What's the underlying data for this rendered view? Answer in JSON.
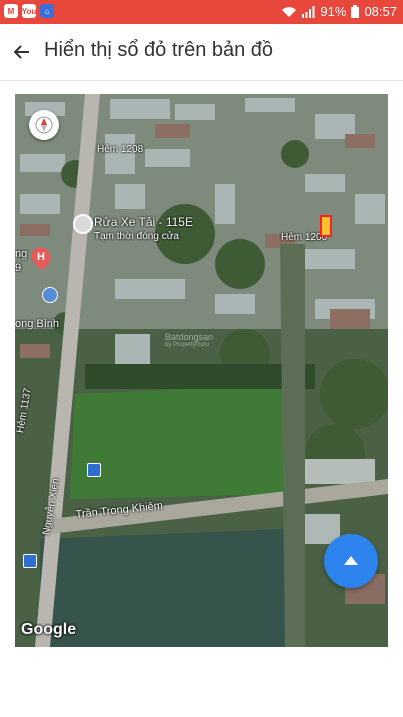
{
  "status_bar": {
    "app_icons": [
      "M",
      "You",
      "home"
    ],
    "battery": "91%",
    "time": "08:57",
    "color": "#e8473c"
  },
  "header": {
    "title": "Hiển thị sổ đỏ trên bản đồ",
    "back_icon": "arrow-left-icon"
  },
  "map": {
    "poi": {
      "name": "Rửa Xe Tải - 115E",
      "status": "Tạm thời đóng cửa"
    },
    "hospital_marker": "H",
    "street_labels": {
      "hem_1208": "Hẻm 1208",
      "hem_1200": "Hẻm 1200",
      "hem_1137": "Hẻm 1137",
      "nguyen_xien": "Nguyễn Xiển",
      "tran_trong_khiem": "Trần Trọng Khiêm",
      "left_ng": "ng",
      "left_9": "9",
      "left_binh": "ong Bình"
    },
    "watermark": "Batdongsan",
    "watermark_sub": "by PropertyGuru",
    "attribution": "Google"
  },
  "fab": {
    "icon": "arrow-up-icon",
    "color": "#2e84ee"
  }
}
